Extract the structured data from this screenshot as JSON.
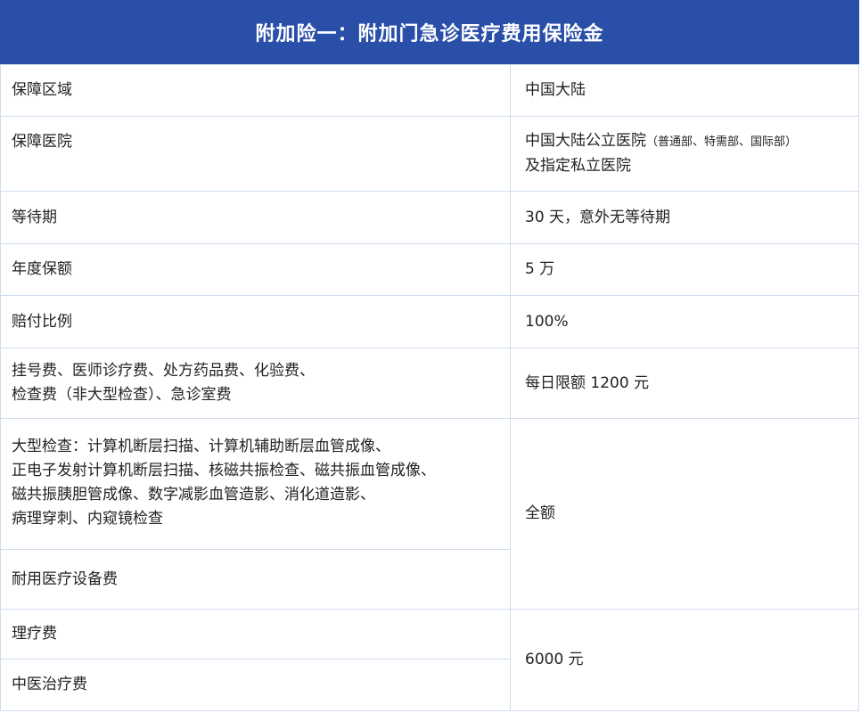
{
  "title": "附加险一：附加门急诊医疗费用保险金",
  "rows": [
    {
      "label": "保障区域",
      "value": "中国大陆"
    },
    {
      "label": "保障医院",
      "value_main": "中国大陆公立医院",
      "value_note": "（普通部、特需部、国际部）",
      "value_line2": "及指定私立医院"
    },
    {
      "label": "等待期",
      "value": "30 天，意外无等待期"
    },
    {
      "label": "年度保额",
      "value": "5 万"
    },
    {
      "label": "赔付比例",
      "value": "100%"
    },
    {
      "label_line1": "挂号费、医师诊疗费、处方药品费、化验费、",
      "label_line2": "检查费（非大型检查）、急诊室费",
      "value": "每日限额 1200 元"
    },
    {
      "label_lines": [
        "大型检查：计算机断层扫描、计算机辅助断层血管成像、",
        "正电子发射计算机断层扫描、核磁共振检查、磁共振血管成像、",
        "磁共振胰胆管成像、数字减影血管造影、消化道造影、",
        "病理穿刺、内窥镜检查"
      ],
      "value": "全额"
    },
    {
      "label": "耐用医疗设备费"
    },
    {
      "label": "理疗费",
      "value": "6000 元"
    },
    {
      "label": "中医治疗费"
    }
  ]
}
